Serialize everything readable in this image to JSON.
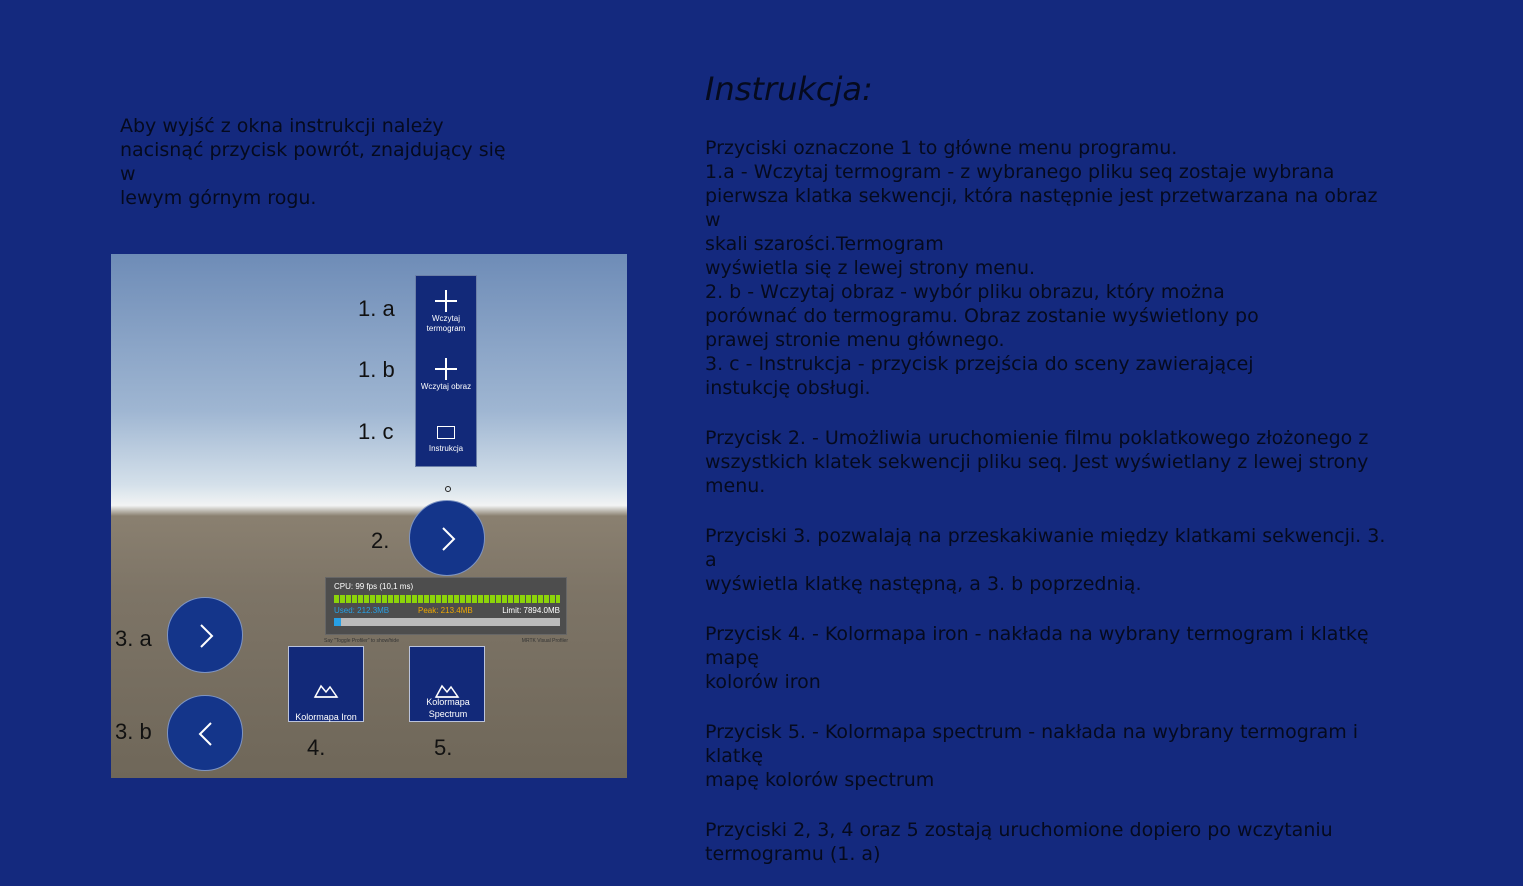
{
  "exit_note": "Aby wyjść z okna instrukcji należy\nnacisnąć przycisk powrót, znajdujący się w\nlewym górnym rogu.",
  "title": "Instrukcja:",
  "paragraphs": [
    "Przyciski oznaczone 1 to główne menu programu.\n       1.a - Wczytaj termogram - z wybranego pliku seq zostaje wybrana\n     pierwsza klatka sekwencji, która następnie jest przetwarzana na obraz w\n     skali szarości.Termogram\n       wyświetla się z lewej strony menu.\n       2. b - Wczytaj obraz - wybór pliku obrazu, który można\n       porównać do termogramu. Obraz zostanie wyświetlony po\n       prawej stronie menu głównego.\n       3. c - Instrukcja - przycisk przejścia do sceny zawierającej\n       instukcję obsługi.",
    "Przycisk 2. - Umożliwia uruchomienie filmu poklatkowego złożonego z\nwszystkich klatek sekwencji pliku seq. Jest wyświetlany z lewej strony\nmenu.",
    "Przyciski 3. pozwalają na przeskakiwanie między klatkami sekwencji. 3. a\nwyświetla klatkę następną, a 3. b poprzednią.",
    "Przycisk 4. - Kolormapa iron - nakłada na wybrany termogram i klatkę mapę\nkolorów iron",
    "Przycisk 5. - Kolormapa spectrum - nakłada na wybrany termogram i klatkę\nmapę kolorów spectrum",
    "Przyciski 2, 3, 4 oraz 5 zostają uruchomione dopiero po wczytaniu\ntermogramu (1. a)"
  ],
  "preview": {
    "labels": {
      "l1a": "1. a",
      "l1b": "1. b",
      "l1c": "1. c",
      "l2": "2.",
      "l3a": "3. a",
      "l3b": "3. b",
      "l4": "4.",
      "l5": "5."
    },
    "menu": {
      "btn1": "Wczytaj termogram",
      "btn2": "Wczytaj obraz",
      "btn3": "Instrukcja"
    },
    "profiler": {
      "cpu": "CPU: 99 fps (10,1 ms)",
      "used": "Used: 212.3MB",
      "peak": "Peak: 213.4MB",
      "limit": "Limit: 7894.0MB",
      "hint": "Say \"Toggle Profiler\" to show/hide",
      "brand": "MRTK Visual Profiler",
      "memory_fraction": 0.03
    },
    "colormap_iron": "Kolormapa Iron",
    "colormap_spectrum": "Kolormapa Spectrum"
  },
  "colors": {
    "background": "#14297e",
    "button": "#122979",
    "text": "#050a1e"
  },
  "icons": [
    "plus-icon",
    "chat-icon",
    "chevron-right-icon",
    "chevron-left-icon",
    "landscape-icon"
  ]
}
